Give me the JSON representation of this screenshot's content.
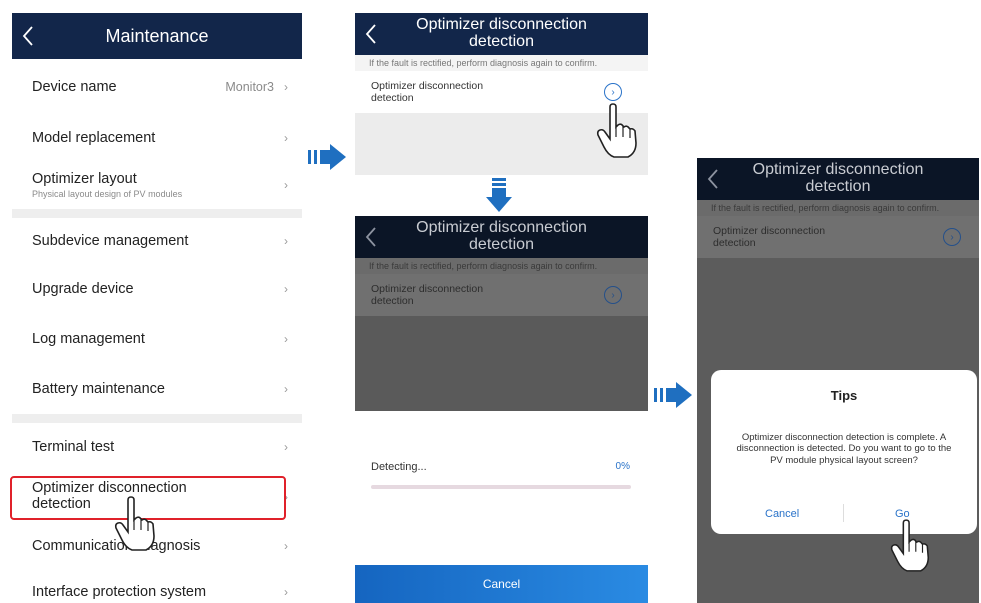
{
  "maintenance": {
    "title": "Maintenance",
    "items": [
      {
        "label": "Device name",
        "value": "Monitor3"
      },
      {
        "label": "Model replacement"
      },
      {
        "label": "Optimizer layout",
        "sub": "Physical layout design of PV modules"
      },
      {
        "label": "Subdevice management"
      },
      {
        "label": "Upgrade device"
      },
      {
        "label": "Log management"
      },
      {
        "label": "Battery maintenance"
      },
      {
        "label": "Terminal test"
      },
      {
        "label": "Optimizer disconnection detection"
      },
      {
        "label": "Communication Diagnosis"
      },
      {
        "label": "Interface protection system"
      }
    ]
  },
  "detection": {
    "title": "Optimizer disconnection detection",
    "hint": "If the fault is rectified, perform diagnosis again to confirm.",
    "row_label": "Optimizer disconnection detection"
  },
  "progress": {
    "status": "Detecting...",
    "percent_text": "0%",
    "percent": 0,
    "cancel_label": "Cancel"
  },
  "tips": {
    "title": "Tips",
    "message": "Optimizer disconnection detection is complete. A disconnection is detected. Do you want to go to the PV module physical layout screen?",
    "cancel_label": "Cancel",
    "go_label": "Go"
  },
  "icons": {
    "back": "chevron-left-icon",
    "chevron": "chevron-right-icon",
    "circle_arrow": "circle-arrow-right-icon",
    "pointer": "hand-pointer-icon",
    "flow_arrow": "flow-arrow-icon"
  },
  "colors": {
    "navbar": "#12264a",
    "accent": "#2a73c9",
    "highlight": "#e0212a"
  }
}
